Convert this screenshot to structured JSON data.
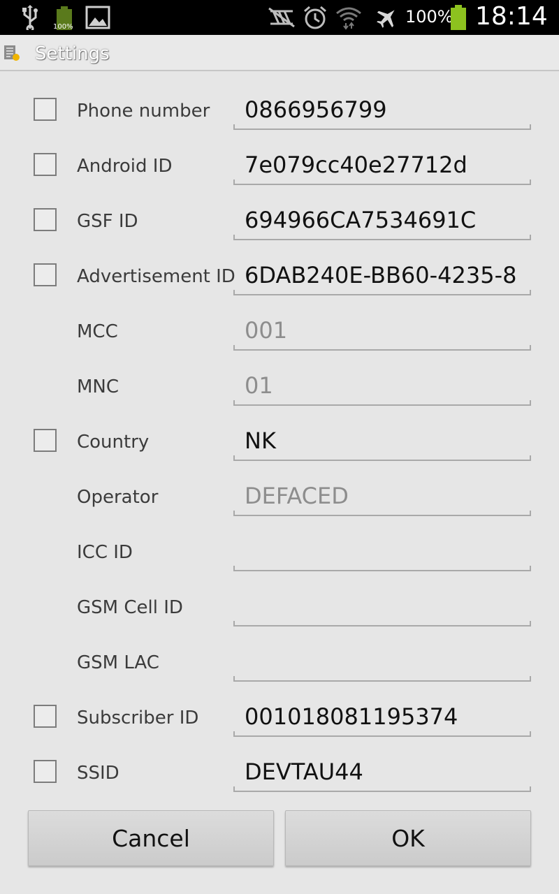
{
  "status_bar": {
    "battery_small_label": "100%",
    "battery_percent": "100%",
    "time": "18:14",
    "icons": [
      "usb-icon",
      "battery-small-icon",
      "image-icon",
      "no-sim-icon",
      "alarm-icon",
      "wifi-icon",
      "airplane-icon",
      "battery-icon"
    ],
    "battery_color": "#8dc21f"
  },
  "title_bar": {
    "title": "Settings"
  },
  "fields": [
    {
      "label": "Phone number",
      "value": "0866956799",
      "has_checkbox": true,
      "enabled": true
    },
    {
      "label": "Android ID",
      "value": "7e079cc40e27712d",
      "has_checkbox": true,
      "enabled": true
    },
    {
      "label": "GSF ID",
      "value": "694966CA7534691C",
      "has_checkbox": true,
      "enabled": true
    },
    {
      "label": "Advertisement ID",
      "value": "6DAB240E-BB60-4235-8",
      "has_checkbox": true,
      "enabled": true
    },
    {
      "label": "MCC",
      "value": "001",
      "has_checkbox": false,
      "enabled": false
    },
    {
      "label": "MNC",
      "value": "01",
      "has_checkbox": false,
      "enabled": false
    },
    {
      "label": "Country",
      "value": "NK",
      "has_checkbox": true,
      "enabled": true
    },
    {
      "label": "Operator",
      "value": "DEFACED",
      "has_checkbox": false,
      "enabled": false
    },
    {
      "label": "ICC ID",
      "value": "",
      "has_checkbox": false,
      "enabled": false
    },
    {
      "label": "GSM Cell ID",
      "value": "",
      "has_checkbox": false,
      "enabled": false
    },
    {
      "label": "GSM LAC",
      "value": "",
      "has_checkbox": false,
      "enabled": false
    },
    {
      "label": "Subscriber ID",
      "value": "001018081195374",
      "has_checkbox": true,
      "enabled": true
    },
    {
      "label": "SSID",
      "value": "DEVTAU44",
      "has_checkbox": true,
      "enabled": true
    }
  ],
  "buttons": {
    "cancel_label": "Cancel",
    "ok_label": "OK"
  }
}
